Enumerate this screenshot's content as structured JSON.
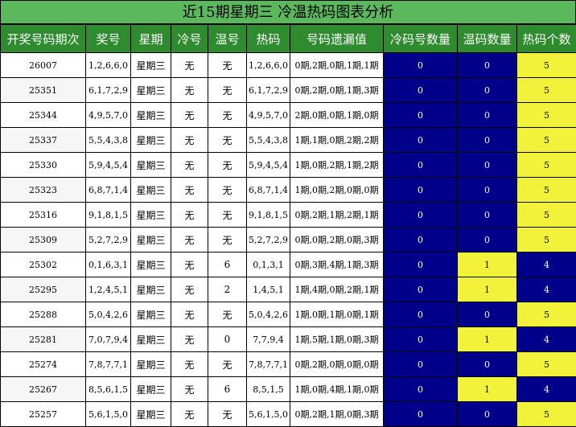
{
  "title": "近15期星期三 冷温热码图表分析",
  "headers": [
    "开奖号码期次",
    "奖号",
    "星期",
    "冷号",
    "温号",
    "热码",
    "号码遗漏值",
    "冷码号数量",
    "温码数量",
    "热码个数"
  ],
  "rows": [
    {
      "issue": "26007",
      "award": "1,2,6,6,0",
      "weekday": "星期三",
      "cold": "无",
      "warm": "无",
      "hot": "1,2,6,6,0",
      "miss": "0期,2期,0期,1期,1期",
      "cold_count": "0",
      "warm_count": "0",
      "hot_count": "5"
    },
    {
      "issue": "25351",
      "award": "6,1,7,2,9",
      "weekday": "星期三",
      "cold": "无",
      "warm": "无",
      "hot": "6,1,7,2,9",
      "miss": "0期,2期,0期,1期,3期",
      "cold_count": "0",
      "warm_count": "0",
      "hot_count": "5"
    },
    {
      "issue": "25344",
      "award": "4,9,5,7,0",
      "weekday": "星期三",
      "cold": "无",
      "warm": "无",
      "hot": "4,9,5,7,0",
      "miss": "2期,0期,0期,1期,0期",
      "cold_count": "0",
      "warm_count": "0",
      "hot_count": "5"
    },
    {
      "issue": "25337",
      "award": "5,5,4,3,8",
      "weekday": "星期三",
      "cold": "无",
      "warm": "无",
      "hot": "5,5,4,3,8",
      "miss": "1期,1期,0期,2期,2期",
      "cold_count": "0",
      "warm_count": "0",
      "hot_count": "5"
    },
    {
      "issue": "25330",
      "award": "5,9,4,5,4",
      "weekday": "星期三",
      "cold": "无",
      "warm": "无",
      "hot": "5,9,4,5,4",
      "miss": "1期,0期,2期,1期,2期",
      "cold_count": "0",
      "warm_count": "0",
      "hot_count": "5"
    },
    {
      "issue": "25323",
      "award": "6,8,7,1,4",
      "weekday": "星期三",
      "cold": "无",
      "warm": "无",
      "hot": "6,8,7,1,4",
      "miss": "1期,0期,2期,0期,0期",
      "cold_count": "0",
      "warm_count": "0",
      "hot_count": "5"
    },
    {
      "issue": "25316",
      "award": "9,1,8,1,5",
      "weekday": "星期三",
      "cold": "无",
      "warm": "无",
      "hot": "9,1,8,1,5",
      "miss": "0期,2期,1期,2期,1期",
      "cold_count": "0",
      "warm_count": "0",
      "hot_count": "5"
    },
    {
      "issue": "25309",
      "award": "5,2,7,2,9",
      "weekday": "星期三",
      "cold": "无",
      "warm": "无",
      "hot": "5,2,7,2,9",
      "miss": "0期,0期,2期,0期,3期",
      "cold_count": "0",
      "warm_count": "0",
      "hot_count": "5"
    },
    {
      "issue": "25302",
      "award": "0,1,6,3,1",
      "weekday": "星期三",
      "cold": "无",
      "warm": "6",
      "hot": "0,1,3,1",
      "miss": "0期,3期,4期,1期,3期",
      "cold_count": "0",
      "warm_count": "1",
      "hot_count": "4"
    },
    {
      "issue": "25295",
      "award": "1,2,4,5,1",
      "weekday": "星期三",
      "cold": "无",
      "warm": "2",
      "hot": "1,4,5,1",
      "miss": "1期,4期,0期,2期,1期",
      "cold_count": "0",
      "warm_count": "1",
      "hot_count": "4"
    },
    {
      "issue": "25288",
      "award": "5,0,4,2,6",
      "weekday": "星期三",
      "cold": "无",
      "warm": "无",
      "hot": "5,0,4,2,6",
      "miss": "1期,0期,1期,0期,1期",
      "cold_count": "0",
      "warm_count": "0",
      "hot_count": "5"
    },
    {
      "issue": "25281",
      "award": "7,0,7,9,4",
      "weekday": "星期三",
      "cold": "无",
      "warm": "0",
      "hot": "7,7,9,4",
      "miss": "1期,5期,1期,0期,3期",
      "cold_count": "0",
      "warm_count": "1",
      "hot_count": "4"
    },
    {
      "issue": "25274",
      "award": "7,8,7,7,1",
      "weekday": "星期三",
      "cold": "无",
      "warm": "无",
      "hot": "7,8,7,7,1",
      "miss": "0期,2期,0期,0期,0期",
      "cold_count": "0",
      "warm_count": "0",
      "hot_count": "5"
    },
    {
      "issue": "25267",
      "award": "8,5,6,1,5",
      "weekday": "星期三",
      "cold": "无",
      "warm": "6",
      "hot": "8,5,1,5",
      "miss": "1期,0期,4期,1期,0期",
      "cold_count": "0",
      "warm_count": "1",
      "hot_count": "4"
    },
    {
      "issue": "25257",
      "award": "5,6,1,5,0",
      "weekday": "星期三",
      "cold": "无",
      "warm": "无",
      "hot": "5,6,1,5,0",
      "miss": "0期,2期,1期,0期,3期",
      "cold_count": "0",
      "warm_count": "0",
      "hot_count": "5"
    }
  ],
  "colors": {
    "title_bg": "#5cb85c",
    "header_bg": "#2e8b2e",
    "blue": "#00008b",
    "yellow": "#f2f23a"
  }
}
